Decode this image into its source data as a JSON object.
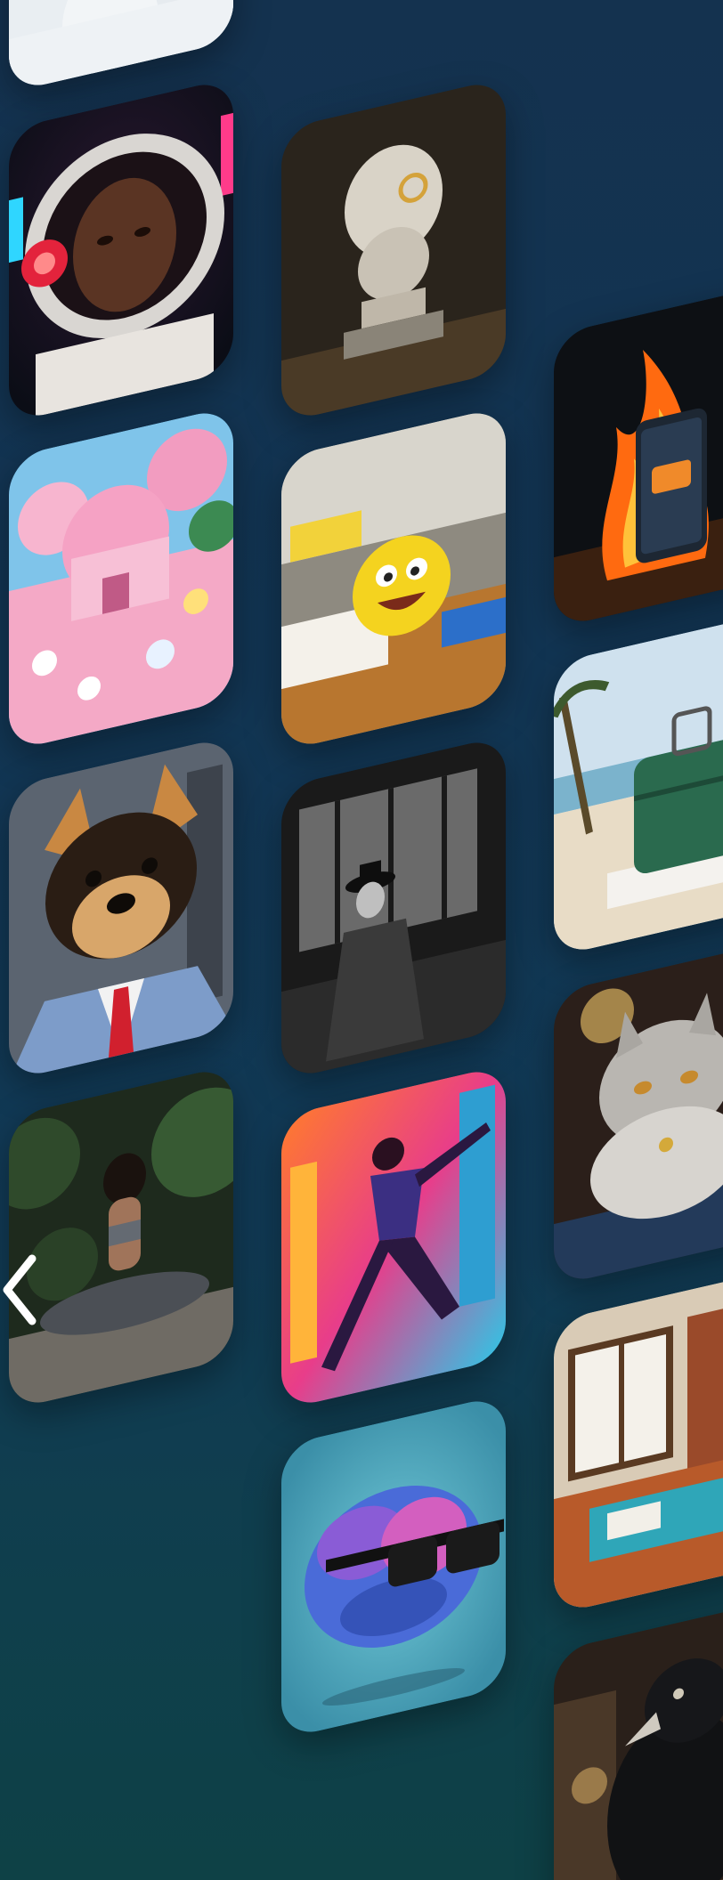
{
  "gallery": {
    "items": [
      {
        "id": "clouds",
        "icon": "clouds-image"
      },
      {
        "id": "astronaut",
        "icon": "astronaut-portrait-image"
      },
      {
        "id": "bust",
        "icon": "monocle-bust-image"
      },
      {
        "id": "pink-world",
        "icon": "pink-fantasy-world-image"
      },
      {
        "id": "emoji-desk",
        "icon": "emoji-desk-image"
      },
      {
        "id": "burning-phone",
        "icon": "burning-phone-image"
      },
      {
        "id": "dog-suit",
        "icon": "dog-in-suit-image"
      },
      {
        "id": "noir",
        "icon": "noir-detective-image"
      },
      {
        "id": "suitcase",
        "icon": "beach-suitcase-image"
      },
      {
        "id": "yoga",
        "icon": "yoga-woman-image"
      },
      {
        "id": "dancer",
        "icon": "neon-dancer-image"
      },
      {
        "id": "cat",
        "icon": "persian-cat-image"
      },
      {
        "id": "brain",
        "icon": "brain-sunglasses-image"
      },
      {
        "id": "workshop",
        "icon": "workshop-room-image"
      },
      {
        "id": "crow",
        "icon": "crow-image"
      }
    ]
  },
  "navigation": {
    "prev_icon": "chevron-left-icon"
  }
}
